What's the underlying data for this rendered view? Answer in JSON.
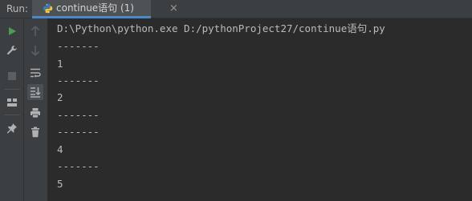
{
  "header": {
    "run_label": "Run:",
    "tab_title": "continue语句 (1)",
    "tab_close": "×"
  },
  "toolbar": {
    "left": [
      "run-icon",
      "wrench-icon",
      "stop-icon",
      "layout-icon",
      "pin-icon"
    ],
    "right": [
      "arrow-up-icon",
      "arrow-down-icon",
      "soft-wrap-icon",
      "scroll-to-end-icon",
      "print-icon",
      "trash-icon"
    ]
  },
  "console": {
    "lines": [
      "D:\\Python\\python.exe D:/pythonProject27/continue语句.py",
      "-------",
      "1",
      "-------",
      "2",
      "-------",
      "-------",
      "4",
      "-------",
      "5"
    ]
  },
  "colors": {
    "background": "#2b2b2b",
    "panel": "#3c3f41",
    "tab_accent": "#4a88c7",
    "text": "#bbbbbb",
    "run_green": "#499c54"
  }
}
